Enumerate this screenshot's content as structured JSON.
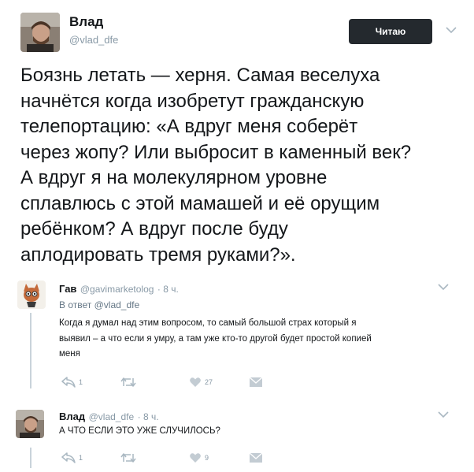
{
  "main_tweet": {
    "author_name": "Влад",
    "author_handle": "@vlad_dfe",
    "follow_label": "Читаю",
    "text_lines": [
      "Боязнь летать — херня. Самая веселуха",
      "начнётся когда изобретут гражданскую",
      "телепортацию: «А вдруг меня соберёт",
      "через жопу? Или выбросит в каменный век?",
      "А вдруг я на молекулярном уровне",
      "сплавлюсь с этой мамашей и её орущим",
      "ребёнком? А вдруг после буду",
      "аплодировать тремя руками?»."
    ]
  },
  "replies": [
    {
      "author_name": "Гав",
      "author_handle": "@gavimarketolog",
      "time": "· 8 ч.",
      "reply_to": "В ответ @vlad_dfe",
      "text_lines": [
        "Когда я думал над этим вопросом, то самый большой страх который я",
        "выявил – а что если я умру, а там уже кто-то другой будет простой копией",
        "меня"
      ],
      "replies_count": "1",
      "retweets_count": "",
      "likes_count": "27"
    },
    {
      "author_name": "Влад",
      "author_handle": "@vlad_dfe",
      "time": "· 8 ч.",
      "text": "А ЧТО ЕСЛИ ЭТО УЖЕ СЛУЧИЛОСЬ?",
      "replies_count": "1",
      "retweets_count": "",
      "likes_count": "9"
    }
  ],
  "colors": {
    "text": "#14171a",
    "secondary": "#8899a6",
    "button_bg": "#24292e",
    "thread_line": "#c9d3da"
  },
  "icons": [
    "chevron-down-icon",
    "reply-icon",
    "retweet-icon",
    "like-icon",
    "dm-icon"
  ]
}
